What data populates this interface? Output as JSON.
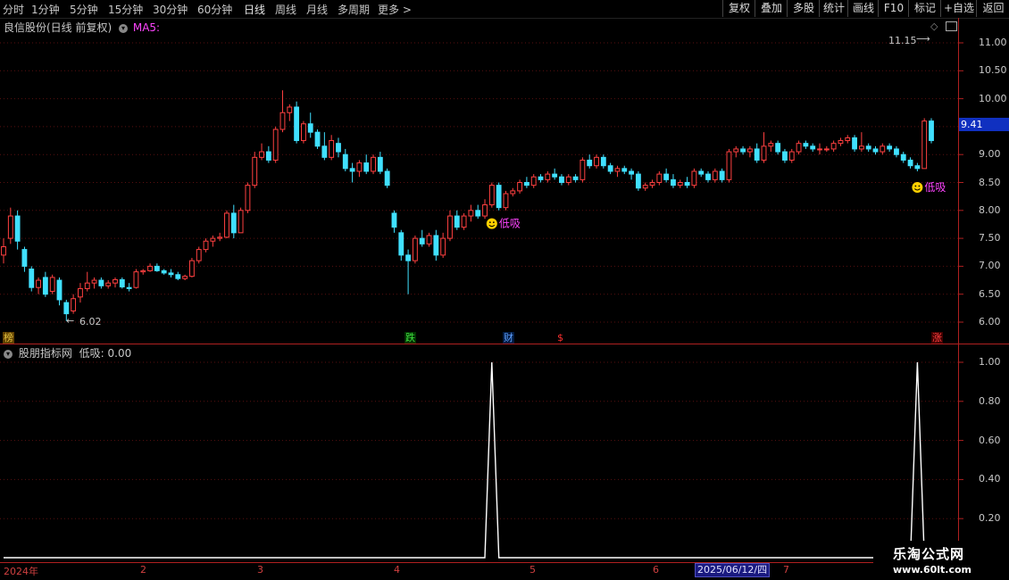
{
  "toolbar": {
    "periods": [
      "分时",
      "1分钟",
      "5分钟",
      "15分钟",
      "30分钟",
      "60分钟",
      "日线",
      "周线",
      "月线",
      "多周期",
      "更多 >"
    ],
    "active_period": "日线",
    "buttons": [
      "复权",
      "叠加",
      "多股",
      "统计",
      "画线",
      "F10",
      "标记",
      "+自选",
      "返回"
    ]
  },
  "main_chart": {
    "title": "良信股份(日线 前复权)",
    "ma_label": "MA5:",
    "high_label": "11.15",
    "low_label": "6.02",
    "current_price": "9.41",
    "signal_text": "低吸",
    "y_ticks": [
      "11.00",
      "10.50",
      "10.00",
      "9.50",
      "9.00",
      "8.50",
      "8.00",
      "7.50",
      "7.00",
      "6.50",
      "6.00"
    ],
    "event_tags": [
      {
        "text": "榜",
        "color": "#e0c040",
        "bg": "#604000"
      },
      {
        "text": "跌",
        "color": "#40e040",
        "bg": "#003000"
      },
      {
        "text": "财",
        "color": "#60a0ff",
        "bg": "#001a40"
      },
      {
        "text": "$",
        "color": "#ff3030",
        "bg": "#000"
      },
      {
        "text": "涨",
        "color": "#ff4040",
        "bg": "#400000"
      }
    ],
    "colors": {
      "up": "#ff4040",
      "down": "#40e0ff",
      "axis": "#b02020",
      "ma": "#ff44ff"
    }
  },
  "indicator": {
    "title": "股朋指标网",
    "value_label": "低吸: 0.00",
    "y_ticks": [
      "1.00",
      "0.80",
      "0.60",
      "0.40",
      "0.20"
    ]
  },
  "x_axis": {
    "labels": [
      "2024年",
      "2",
      "3",
      "4",
      "5",
      "6",
      "7"
    ],
    "cursor_date": "2025/06/12/四"
  },
  "watermark": {
    "title": "乐淘公式网",
    "url": "www.60lt.com"
  },
  "chart_data": {
    "type": "candlestick",
    "ohlc": [
      [
        7.2,
        7.5,
        7.05,
        7.35
      ],
      [
        7.5,
        8.05,
        7.4,
        7.9
      ],
      [
        7.9,
        8.0,
        7.3,
        7.45
      ],
      [
        7.3,
        7.35,
        6.9,
        7.0
      ],
      [
        6.95,
        7.0,
        6.55,
        6.62
      ],
      [
        6.62,
        6.8,
        6.5,
        6.75
      ],
      [
        6.8,
        6.9,
        6.45,
        6.5
      ],
      [
        6.55,
        6.85,
        6.5,
        6.8
      ],
      [
        6.75,
        6.8,
        6.3,
        6.4
      ],
      [
        6.35,
        6.4,
        6.02,
        6.15
      ],
      [
        6.2,
        6.5,
        6.15,
        6.42
      ],
      [
        6.45,
        6.7,
        6.35,
        6.6
      ],
      [
        6.6,
        6.9,
        6.55,
        6.7
      ],
      [
        6.7,
        6.8,
        6.6,
        6.75
      ],
      [
        6.75,
        6.8,
        6.6,
        6.65
      ],
      [
        6.65,
        6.75,
        6.6,
        6.7
      ],
      [
        6.7,
        6.8,
        6.62,
        6.76
      ],
      [
        6.76,
        6.8,
        6.6,
        6.63
      ],
      [
        6.62,
        6.7,
        6.55,
        6.6
      ],
      [
        6.62,
        6.95,
        6.6,
        6.9
      ],
      [
        6.9,
        6.95,
        6.85,
        6.92
      ],
      [
        6.92,
        7.05,
        6.9,
        7.0
      ],
      [
        7.0,
        7.05,
        6.9,
        6.92
      ],
      [
        6.92,
        6.95,
        6.85,
        6.88
      ],
      [
        6.88,
        6.95,
        6.8,
        6.85
      ],
      [
        6.85,
        6.9,
        6.75,
        6.78
      ],
      [
        6.78,
        6.85,
        6.75,
        6.82
      ],
      [
        6.82,
        7.15,
        6.8,
        7.1
      ],
      [
        7.1,
        7.35,
        7.05,
        7.3
      ],
      [
        7.3,
        7.5,
        7.25,
        7.45
      ],
      [
        7.45,
        7.55,
        7.35,
        7.5
      ],
      [
        7.5,
        7.6,
        7.45,
        7.52
      ],
      [
        7.52,
        8.0,
        7.5,
        7.95
      ],
      [
        7.95,
        8.1,
        7.5,
        7.6
      ],
      [
        7.6,
        8.05,
        7.6,
        8.0
      ],
      [
        8.0,
        8.5,
        7.95,
        8.45
      ],
      [
        8.45,
        9.05,
        8.4,
        8.95
      ],
      [
        8.95,
        9.2,
        8.9,
        9.05
      ],
      [
        9.05,
        9.15,
        8.85,
        8.9
      ],
      [
        8.9,
        9.5,
        8.85,
        9.45
      ],
      [
        9.45,
        10.15,
        9.4,
        9.75
      ],
      [
        9.75,
        9.9,
        9.6,
        9.85
      ],
      [
        9.85,
        9.95,
        9.2,
        9.25
      ],
      [
        9.25,
        9.6,
        9.2,
        9.55
      ],
      [
        9.55,
        9.75,
        9.3,
        9.4
      ],
      [
        9.4,
        9.45,
        9.1,
        9.15
      ],
      [
        9.15,
        9.4,
        8.9,
        8.95
      ],
      [
        8.95,
        9.35,
        8.9,
        9.25
      ],
      [
        9.2,
        9.3,
        8.95,
        9.05
      ],
      [
        9.0,
        9.1,
        8.7,
        8.75
      ],
      [
        8.75,
        8.85,
        8.5,
        8.7
      ],
      [
        8.7,
        8.9,
        8.6,
        8.85
      ],
      [
        8.85,
        9.0,
        8.65,
        8.7
      ],
      [
        8.7,
        9.0,
        8.65,
        8.95
      ],
      [
        8.95,
        9.05,
        8.65,
        8.7
      ],
      [
        8.7,
        8.75,
        8.4,
        8.45
      ],
      [
        7.95,
        8.0,
        7.6,
        7.7
      ],
      [
        7.6,
        7.65,
        7.1,
        7.2
      ],
      [
        7.2,
        7.3,
        6.5,
        7.1
      ],
      [
        7.1,
        7.55,
        7.05,
        7.5
      ],
      [
        7.5,
        7.65,
        7.35,
        7.4
      ],
      [
        7.4,
        7.6,
        7.35,
        7.55
      ],
      [
        7.55,
        7.65,
        7.1,
        7.2
      ],
      [
        7.2,
        7.6,
        7.15,
        7.5
      ],
      [
        7.5,
        8.0,
        7.45,
        7.9
      ],
      [
        7.9,
        8.0,
        7.65,
        7.7
      ],
      [
        7.7,
        7.95,
        7.65,
        7.9
      ],
      [
        7.9,
        8.1,
        7.8,
        8.0
      ],
      [
        8.0,
        8.1,
        7.85,
        7.9
      ],
      [
        7.9,
        8.2,
        7.85,
        8.1
      ],
      [
        8.1,
        8.5,
        8.05,
        8.45
      ],
      [
        8.45,
        8.5,
        8.0,
        8.05
      ],
      [
        8.05,
        8.35,
        8.0,
        8.3
      ],
      [
        8.3,
        8.4,
        8.25,
        8.35
      ],
      [
        8.35,
        8.55,
        8.3,
        8.5
      ],
      [
        8.5,
        8.6,
        8.4,
        8.45
      ],
      [
        8.45,
        8.65,
        8.4,
        8.6
      ],
      [
        8.6,
        8.65,
        8.5,
        8.55
      ],
      [
        8.55,
        8.7,
        8.5,
        8.65
      ],
      [
        8.65,
        8.75,
        8.55,
        8.6
      ],
      [
        8.6,
        8.65,
        8.45,
        8.5
      ],
      [
        8.5,
        8.65,
        8.45,
        8.6
      ],
      [
        8.6,
        8.65,
        8.5,
        8.55
      ],
      [
        8.55,
        8.95,
        8.5,
        8.9
      ],
      [
        8.9,
        9.0,
        8.75,
        8.8
      ],
      [
        8.8,
        9.0,
        8.75,
        8.95
      ],
      [
        8.95,
        9.0,
        8.75,
        8.8
      ],
      [
        8.8,
        8.85,
        8.65,
        8.7
      ],
      [
        8.7,
        8.8,
        8.6,
        8.75
      ],
      [
        8.75,
        8.8,
        8.65,
        8.7
      ],
      [
        8.7,
        8.75,
        8.55,
        8.65
      ],
      [
        8.65,
        8.7,
        8.35,
        8.4
      ],
      [
        8.4,
        8.5,
        8.35,
        8.45
      ],
      [
        8.45,
        8.55,
        8.4,
        8.5
      ],
      [
        8.5,
        8.7,
        8.45,
        8.65
      ],
      [
        8.65,
        8.75,
        8.5,
        8.55
      ],
      [
        8.55,
        8.65,
        8.4,
        8.45
      ],
      [
        8.45,
        8.55,
        8.4,
        8.5
      ],
      [
        8.5,
        8.6,
        8.4,
        8.45
      ],
      [
        8.45,
        8.75,
        8.4,
        8.7
      ],
      [
        8.7,
        8.75,
        8.6,
        8.65
      ],
      [
        8.65,
        8.7,
        8.5,
        8.55
      ],
      [
        8.55,
        8.75,
        8.5,
        8.7
      ],
      [
        8.7,
        8.75,
        8.5,
        8.55
      ],
      [
        8.55,
        9.1,
        8.5,
        9.05
      ],
      [
        9.05,
        9.15,
        8.95,
        9.1
      ],
      [
        9.1,
        9.15,
        9.0,
        9.05
      ],
      [
        9.05,
        9.15,
        8.95,
        9.1
      ],
      [
        9.1,
        9.2,
        8.85,
        8.9
      ],
      [
        8.9,
        9.4,
        8.85,
        9.15
      ],
      [
        9.15,
        9.25,
        9.05,
        9.2
      ],
      [
        9.2,
        9.25,
        9.0,
        9.05
      ],
      [
        9.05,
        9.1,
        8.85,
        8.9
      ],
      [
        8.9,
        9.1,
        8.85,
        9.05
      ],
      [
        9.05,
        9.25,
        9.0,
        9.2
      ],
      [
        9.2,
        9.25,
        9.1,
        9.15
      ],
      [
        9.15,
        9.2,
        9.05,
        9.1
      ],
      [
        9.1,
        9.2,
        9.0,
        9.1
      ],
      [
        9.1,
        9.15,
        9.05,
        9.1
      ],
      [
        9.1,
        9.25,
        9.05,
        9.2
      ],
      [
        9.2,
        9.3,
        9.15,
        9.25
      ],
      [
        9.25,
        9.35,
        9.2,
        9.3
      ],
      [
        9.3,
        9.35,
        9.05,
        9.1
      ],
      [
        9.1,
        9.4,
        9.05,
        9.15
      ],
      [
        9.15,
        9.2,
        9.05,
        9.1
      ],
      [
        9.1,
        9.15,
        9.0,
        9.05
      ],
      [
        9.05,
        9.2,
        9.0,
        9.15
      ],
      [
        9.15,
        9.2,
        9.05,
        9.1
      ],
      [
        9.1,
        9.15,
        8.95,
        9.0
      ],
      [
        9.0,
        9.05,
        8.85,
        8.9
      ],
      [
        8.9,
        8.95,
        8.75,
        8.8
      ],
      [
        8.8,
        8.85,
        8.7,
        8.75
      ],
      [
        8.75,
        9.65,
        8.75,
        9.6
      ],
      [
        9.6,
        9.65,
        9.2,
        9.25
      ]
    ],
    "signal_bars": [
      70,
      131
    ],
    "signal_price": "8.40",
    "indicator_peaks": [
      1.0,
      1.0
    ],
    "y_range": [
      5.8,
      11.3
    ],
    "indicator_range": [
      0,
      1.05
    ]
  }
}
